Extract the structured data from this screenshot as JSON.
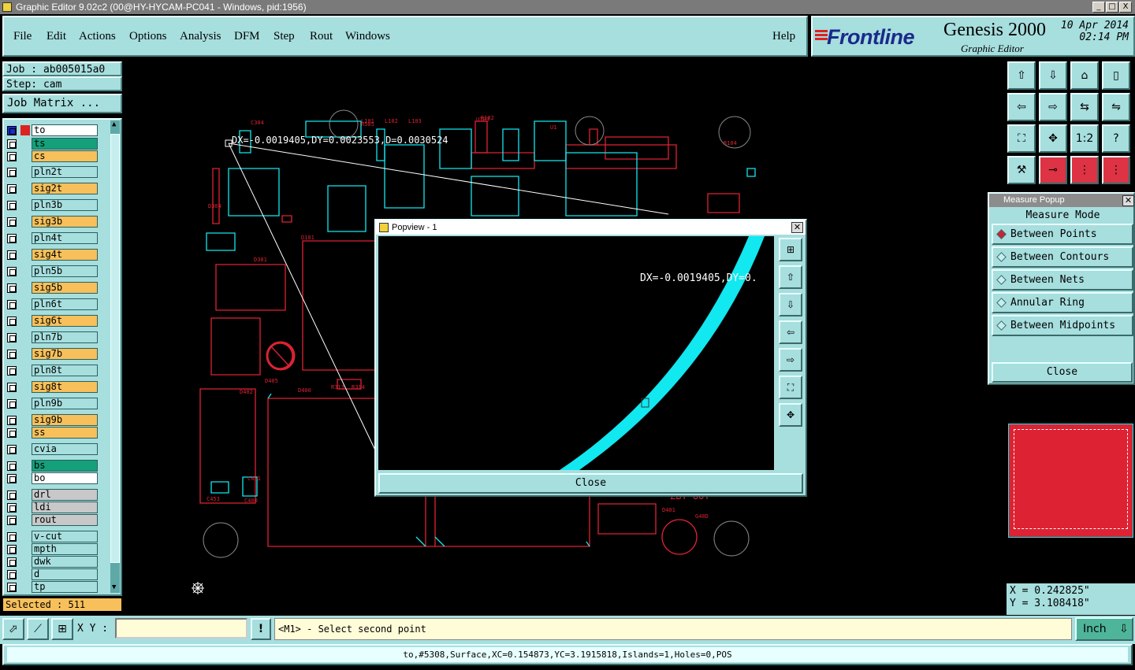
{
  "window": {
    "title": "Graphic Editor 9.02c2 (00@HY-HYCAM-PC041 - Windows, pid:1956)",
    "min": "_",
    "max": "□",
    "close": "X"
  },
  "menu": {
    "items": [
      {
        "label": "File"
      },
      {
        "label": "Edit"
      },
      {
        "label": "Actions"
      },
      {
        "label": "Options"
      },
      {
        "label": "Analysis"
      },
      {
        "label": "DFM"
      },
      {
        "label": "Step"
      },
      {
        "label": "Rout"
      },
      {
        "label": "Windows"
      }
    ],
    "help": "Help"
  },
  "brand": {
    "logo": "Frontline",
    "product": "Genesis 2000",
    "subtitle": "Graphic Editor",
    "date": "10 Apr 2014",
    "time": "02:14 PM"
  },
  "job": {
    "job_label": "Job : ab005015a0",
    "step_label": "Step: cam",
    "matrix_button": "Job Matrix ..."
  },
  "layers": [
    {
      "name": "to",
      "color": "#ffffff"
    },
    {
      "name": "ts",
      "color": "#14a07a"
    },
    {
      "name": "cs",
      "color": "#f7c05a"
    },
    {
      "name": "pln2t",
      "color": "#a7dede"
    },
    {
      "name": "sig2t",
      "color": "#f7c05a"
    },
    {
      "name": "pln3b",
      "color": "#a7dede"
    },
    {
      "name": "sig3b",
      "color": "#f7c05a"
    },
    {
      "name": "pln4t",
      "color": "#a7dede"
    },
    {
      "name": "sig4t",
      "color": "#f7c05a"
    },
    {
      "name": "pln5b",
      "color": "#a7dede"
    },
    {
      "name": "sig5b",
      "color": "#f7c05a"
    },
    {
      "name": "pln6t",
      "color": "#a7dede"
    },
    {
      "name": "sig6t",
      "color": "#f7c05a"
    },
    {
      "name": "pln7b",
      "color": "#a7dede"
    },
    {
      "name": "sig7b",
      "color": "#f7c05a"
    },
    {
      "name": "pln8t",
      "color": "#a7dede"
    },
    {
      "name": "sig8t",
      "color": "#f7c05a"
    },
    {
      "name": "pln9b",
      "color": "#a7dede"
    },
    {
      "name": "sig9b",
      "color": "#f7c05a"
    },
    {
      "name": "ss",
      "color": "#f7c05a"
    },
    {
      "name": "cvia",
      "color": "#a7dede"
    },
    {
      "name": "bs",
      "color": "#14a07a"
    },
    {
      "name": "bo",
      "color": "#ffffff"
    },
    {
      "name": "drl",
      "color": "#c8c8c8"
    },
    {
      "name": "ldi",
      "color": "#c8c8c8"
    },
    {
      "name": "rout",
      "color": "#c8c8c8"
    },
    {
      "name": "v-cut",
      "color": "#a7dede"
    },
    {
      "name": "mpth",
      "color": "#a7dede"
    },
    {
      "name": "dwk",
      "color": "#a7dede"
    },
    {
      "name": "d",
      "color": "#a7dede"
    },
    {
      "name": "tp",
      "color": "#a7dede"
    }
  ],
  "selected": "Selected : 511",
  "canvas": {
    "measure_readout": "DX=-0.0019405,DY=0.0023553,D=0.0030524",
    "bottom_label": "ZBT-UUT",
    "part_labels": [
      "R182",
      "U303",
      "C304",
      "R505",
      "U1",
      "R104",
      "D304",
      "D301",
      "D405",
      "D400",
      "D402",
      "R313",
      "R314",
      "C451",
      "C453",
      "C400",
      "D401",
      "G40D",
      "D101",
      "L101",
      "L102",
      "L103"
    ]
  },
  "popview": {
    "title": "Popview - 1",
    "readout": "DX=-0.0019405,DY=0.",
    "close": "Close"
  },
  "measure_popup": {
    "title": "Measure Popup",
    "mode_label": "Measure Mode",
    "options": [
      {
        "label": "Between Points",
        "selected": true
      },
      {
        "label": "Between Contours",
        "selected": false
      },
      {
        "label": "Between Nets",
        "selected": false
      },
      {
        "label": "Annular Ring",
        "selected": false
      },
      {
        "label": "Between Midpoints",
        "selected": false
      }
    ],
    "close": "Close"
  },
  "coords": {
    "x": "X = 0.242825\"",
    "y": "Y = 3.108418\""
  },
  "bottom": {
    "xy_label": "X Y :",
    "xy_value": "",
    "warn": "!",
    "prompt": "<M1> - Select second point",
    "units": "Inch"
  },
  "status": "to,#5308,Surface,XC=0.154873,YC=3.1915818,Islands=1,Holes=0,POS",
  "colors": {
    "panel": "#a7dede",
    "accent_red": "#dd2233",
    "cyan": "#11e8f0"
  },
  "tool_icons": [
    "home-up-icon",
    "home-down-icon",
    "house-icon",
    "window-icon",
    "pan-left-icon",
    "pan-right-icon",
    "pan-fit-icon",
    "pan-arrows-icon",
    "zoom-fit-icon",
    "zoom-in-icon",
    "ratio-icon",
    "help-icon",
    "tools-icon",
    "probe-icon",
    "net-layers-icon",
    "net-layers-red-icon"
  ],
  "tool_labels": [
    "⇧",
    "⇩",
    "⌂",
    "▯",
    "⇦",
    "⇨",
    "⇆",
    "⇋",
    "⛶",
    "✥",
    "1:2",
    "?",
    "⚒",
    "⊸",
    "⋮",
    "⋮"
  ],
  "pop_side_labels": [
    "⊞",
    "⇧",
    "⇩",
    "⇦",
    "⇨",
    "⛶",
    "✥"
  ]
}
